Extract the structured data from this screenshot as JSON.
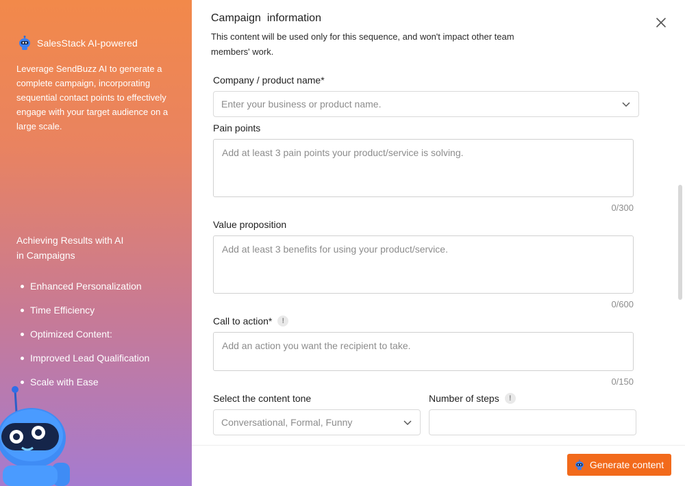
{
  "promo": {
    "brand_name": "SalesStack AI-powered",
    "intro": "Leverage SendBuzz AI to generate a complete campaign, incorporating sequential contact points to effectively engage with your target audience on a large scale.",
    "results_title_line1": "Achieving Results with AI",
    "results_title_line2": "in Campaigns",
    "benefits": [
      "Enhanced Personalization",
      "Time Efficiency",
      "Optimized Content:",
      "Improved Lead Qualification",
      "Scale with Ease"
    ]
  },
  "form": {
    "title": "Campaign  information",
    "description": "This content will be used only for this sequence, and won't impact other team members' work.",
    "company": {
      "label": "Company / product name*",
      "placeholder": "Enter your business or product name."
    },
    "pain_points": {
      "label": "Pain points",
      "placeholder": "Add at least 3 pain points your product/service is solving.",
      "counter": "0/300"
    },
    "value_proposition": {
      "label": "Value proposition",
      "placeholder": "Add at least 3 benefits for using your product/service.",
      "counter": "0/600"
    },
    "call_to_action": {
      "label": "Call to action*",
      "info": "!",
      "placeholder": "Add an action you want the recipient to take.",
      "counter": "0/150"
    },
    "content_tone": {
      "label": "Select the content tone",
      "placeholder": "Conversational, Formal, Funny"
    },
    "number_of_steps": {
      "label": "Number of steps",
      "info": "!",
      "value": ""
    }
  },
  "footer": {
    "generate_label": "Generate content"
  },
  "colors": {
    "accent": "#f26a1b",
    "panel_top": "#f2894a",
    "panel_bottom": "#a57bd0"
  }
}
